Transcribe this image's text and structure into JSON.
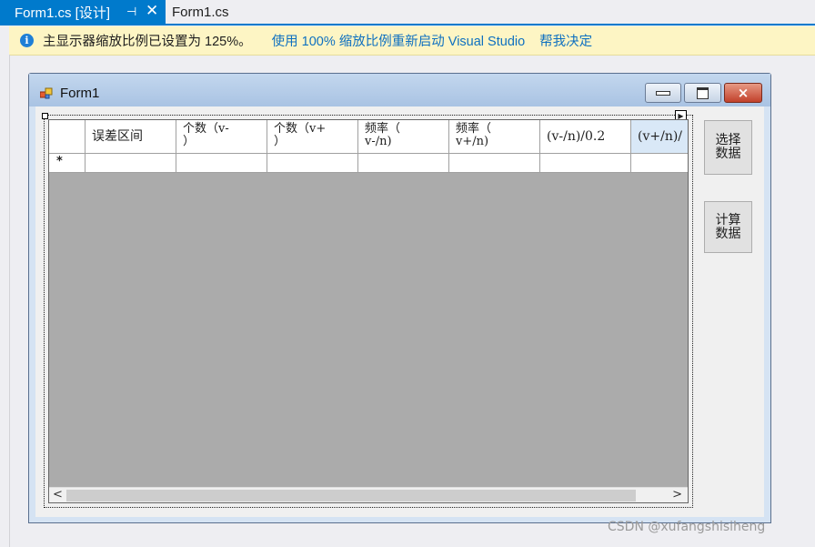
{
  "tabs": {
    "active": {
      "label": "Form1.cs [设计]",
      "pin_icon": "pin-icon",
      "close_icon": "close-icon"
    },
    "inactive": {
      "label": "Form1.cs"
    }
  },
  "infobar": {
    "icon": "info-icon",
    "icon_glyph": "i",
    "message": "主显示器缩放比例已设置为 125%。",
    "link_restart": "使用 100% 缩放比例重新启动 Visual Studio",
    "link_help": "帮我决定"
  },
  "form": {
    "title": "Form1",
    "buttons": {
      "minimize": "minimize-icon",
      "maximize": "maximize-icon",
      "close": "×"
    },
    "grid": {
      "columns": [
        "误差区间",
        "个数（v-\n）",
        "个数（v+\n）",
        "频率（\nv-/n)",
        "频率（\nv+/n)",
        "(v-/n)/0.2",
        "(v+/n)/"
      ],
      "new_row_marker": "*"
    },
    "side_buttons": {
      "select_data": "选择\n数据",
      "compute_data": "计算\n数据"
    }
  },
  "watermark": "CSDN @xufangshisiheng",
  "colors": {
    "accent": "#007acc",
    "infobar_bg": "#fdf5c4",
    "link": "#0e70c0",
    "grid_bg": "#ababab"
  }
}
